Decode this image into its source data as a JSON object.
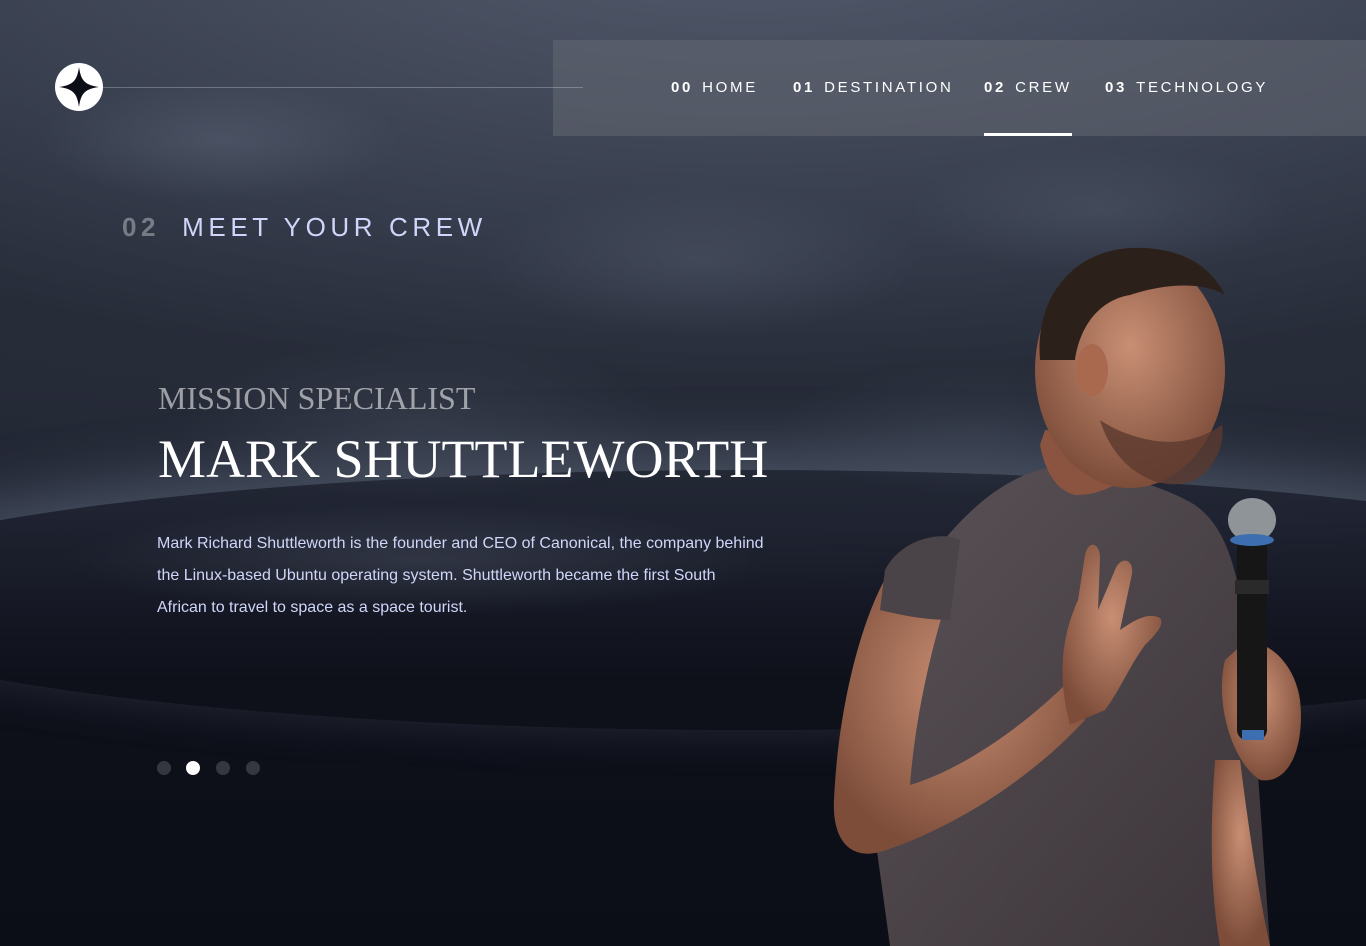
{
  "brand": {
    "logo_icon": "star-icon"
  },
  "nav": {
    "items": [
      {
        "num": "00",
        "label": "HOME",
        "active": false
      },
      {
        "num": "01",
        "label": "DESTINATION",
        "active": false
      },
      {
        "num": "02",
        "label": "CREW",
        "active": true
      },
      {
        "num": "03",
        "label": "TECHNOLOGY",
        "active": false
      }
    ]
  },
  "page": {
    "heading_num": "02",
    "heading_text": "MEET YOUR CREW"
  },
  "crew": {
    "role": "MISSION SPECIALIST",
    "name": "MARK SHUTTLEWORTH",
    "bio": "Mark Richard Shuttleworth is the founder and CEO of Canonical, the company behind the Linux-based Ubuntu operating system. Shuttleworth became the first South African to travel to space as a space tourist.",
    "pagination": {
      "count": 4,
      "active_index": 1
    }
  },
  "colors": {
    "background": "#0b0d17",
    "accent_text": "#d0d6f9",
    "white": "#ffffff"
  }
}
